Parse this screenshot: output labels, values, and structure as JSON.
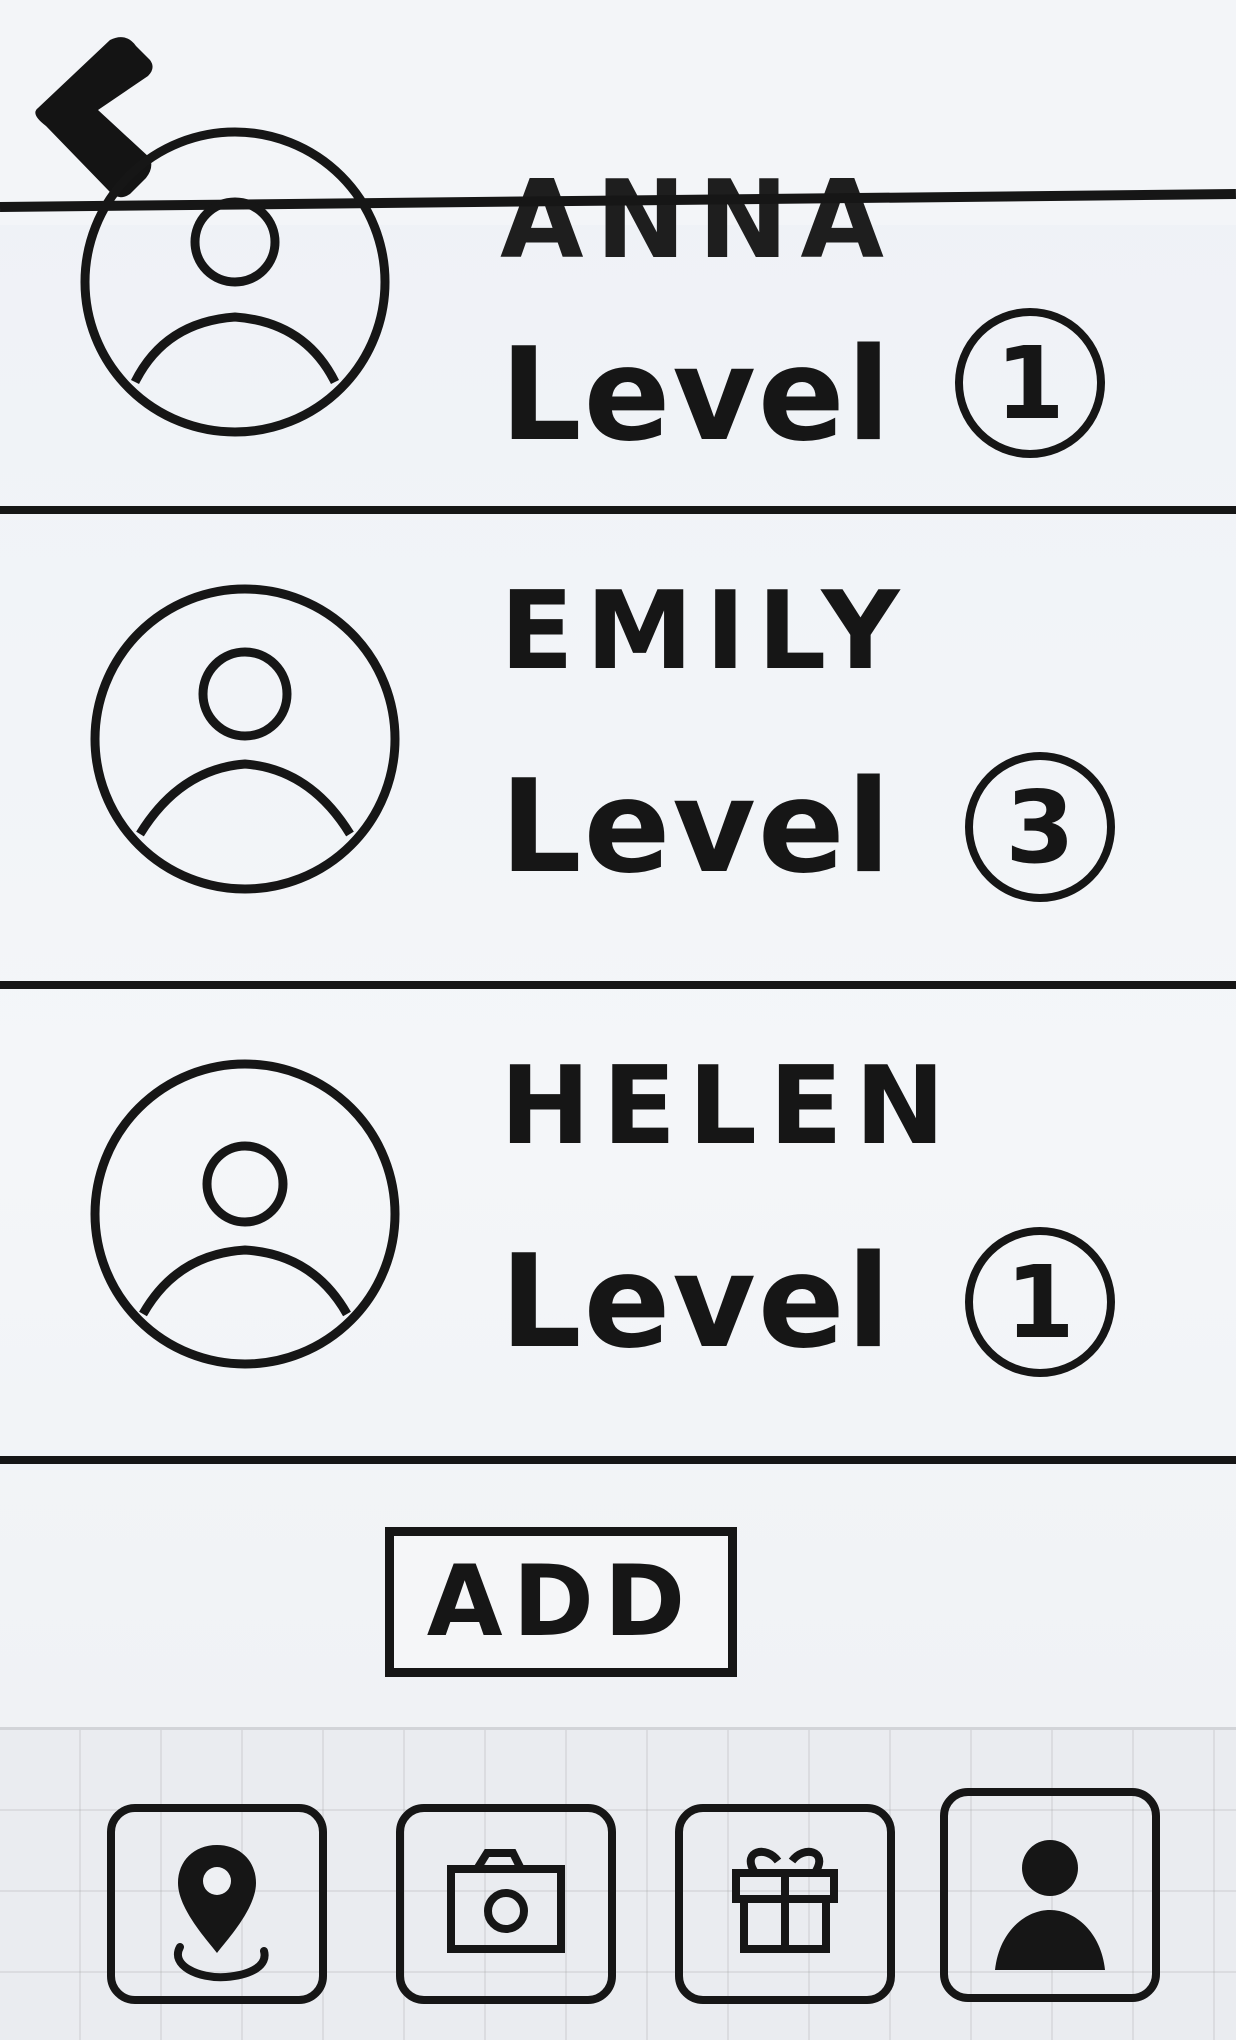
{
  "header": {
    "back_icon": "back-arrow-icon"
  },
  "contacts": [
    {
      "name": "ANNA",
      "level_label": "Level",
      "level_value": "1",
      "avatar_icon": "person-avatar-icon"
    },
    {
      "name": "EMILY",
      "level_label": "Level",
      "level_value": "3",
      "avatar_icon": "person-avatar-icon"
    },
    {
      "name": "HELEN",
      "level_label": "Level",
      "level_value": "1",
      "avatar_icon": "person-avatar-icon"
    }
  ],
  "actions": {
    "add_label": "ADD"
  },
  "bottom_nav": {
    "items": [
      {
        "icon": "location-pin-icon"
      },
      {
        "icon": "camera-icon"
      },
      {
        "icon": "gift-icon"
      },
      {
        "icon": "profile-icon",
        "active": true
      }
    ]
  }
}
